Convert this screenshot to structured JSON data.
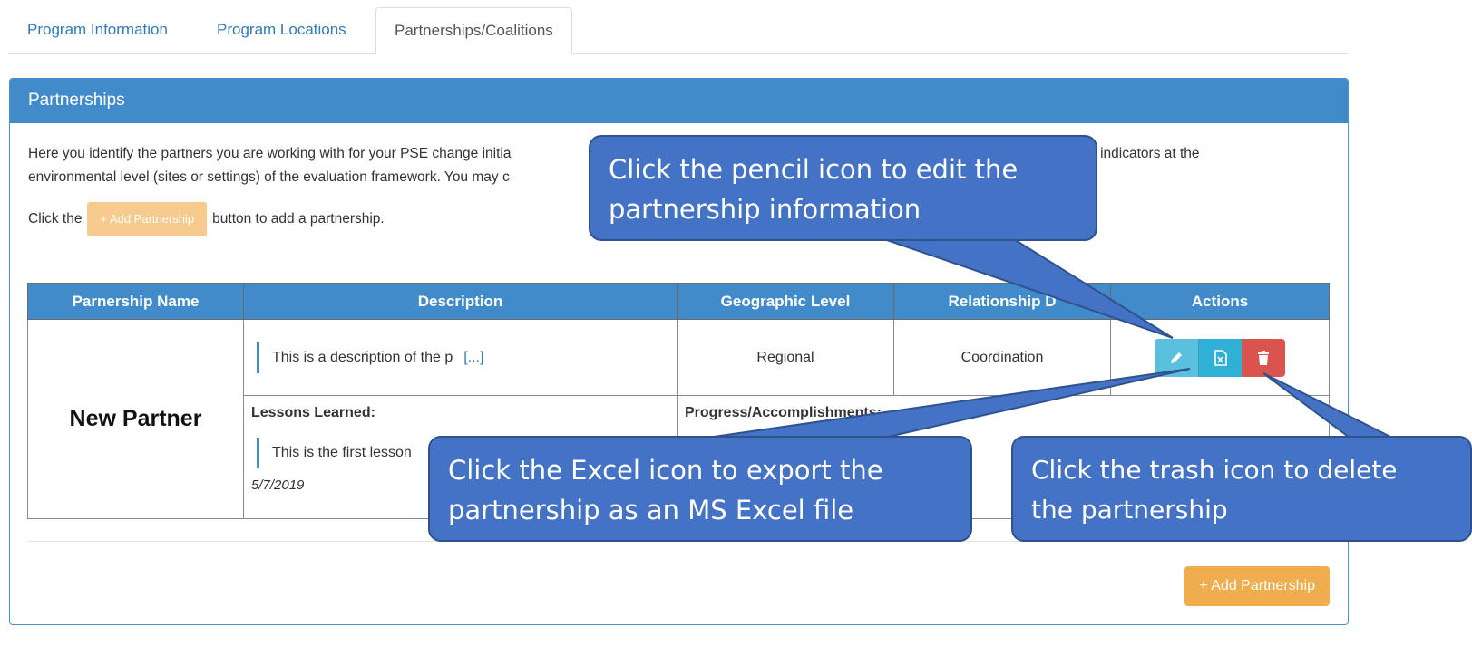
{
  "tabs": [
    {
      "label": "Program Information",
      "active": false
    },
    {
      "label": "Program Locations",
      "active": false
    },
    {
      "label": "Partnerships/Coalitions",
      "active": true
    }
  ],
  "panel": {
    "title": "Partnerships",
    "intro_line1_start": "Here you identify the partners you are working with for your PSE change initia",
    "intro_line1_end": "e measures in indicators at the",
    "intro_line2": "environmental level (sites or settings) of the evaluation framework. You may c",
    "click_prefix": "Click the",
    "click_button_label": "+ Add Partnership",
    "click_suffix": "button to add a partnership."
  },
  "table": {
    "headers": [
      "Parnership Name",
      "Description",
      "Geographic Level",
      "Relationship D",
      "Actions"
    ],
    "row": {
      "name": "New Partner",
      "description": "This is a description of the p",
      "more_label": "[...]",
      "geographic_level": "Regional",
      "relationship": "Coordination",
      "lessons_label": "Lessons Learned:",
      "lesson_text": "This is the first lesson",
      "lesson_date": "5/7/2019",
      "progress_label": "Progress/Accomplishments:"
    }
  },
  "footer": {
    "add_button_label": "+ Add Partnership"
  },
  "callouts": {
    "pencil": {
      "line1": "Click the pencil icon to edit the",
      "line2": "partnership information"
    },
    "excel": {
      "line1": "Click the Excel icon to export the",
      "line2": "partnership as an MS Excel file"
    },
    "trash": {
      "line1": "Click the trash icon to delete",
      "line2": "the partnership"
    }
  },
  "colors": {
    "primary": "#428bca",
    "info": "#5bc0de",
    "danger": "#d9534f",
    "warning": "#f0ad4e",
    "callout": "#4472c4"
  },
  "icons": [
    "pencil-icon",
    "excel-file-icon",
    "trash-icon",
    "plus-icon"
  ]
}
